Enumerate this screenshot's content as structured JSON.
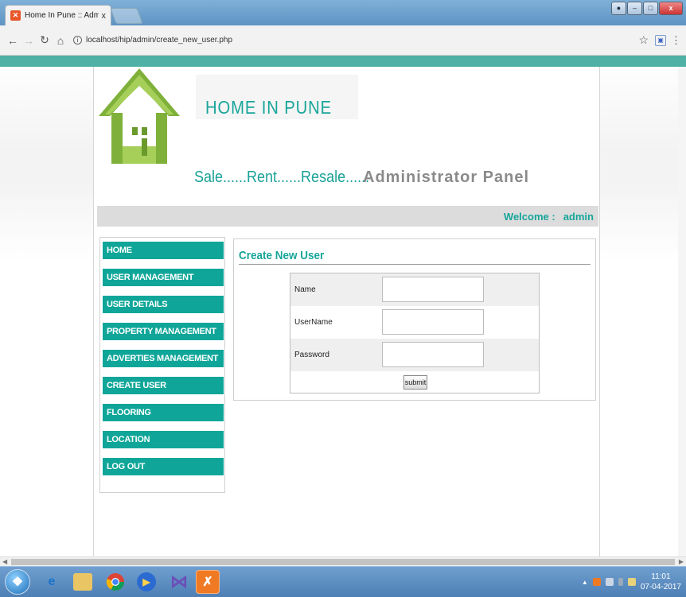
{
  "browser": {
    "tab_title": "Home In Pune :: Adminis",
    "tab_close": "x",
    "url": "localhost/hip/admin/create_new_user.php",
    "window_buttons": {
      "minimize": "–",
      "maximize": "□",
      "close": "x"
    }
  },
  "header": {
    "brand": "HOME IN PUNE",
    "tagline": "Sale......Rent......Resale......",
    "panel_title": "Administrator Panel"
  },
  "welcome": {
    "label": "Welcome :",
    "user": "admin"
  },
  "sidebar": {
    "items": [
      {
        "label": "HOME"
      },
      {
        "label": "USER MANAGEMENT"
      },
      {
        "label": "USER DETAILS"
      },
      {
        "label": "PROPERTY MANAGEMENT"
      },
      {
        "label": "ADVERTIES MANAGEMENT"
      },
      {
        "label": "CREATE USER"
      },
      {
        "label": "FLOORING"
      },
      {
        "label": "LOCATION"
      },
      {
        "label": "LOG OUT"
      }
    ]
  },
  "form": {
    "title": "Create New User",
    "fields": [
      {
        "label": "Name",
        "value": ""
      },
      {
        "label": "UserName",
        "value": ""
      },
      {
        "label": "Password",
        "value": ""
      }
    ],
    "submit_label": "submit"
  },
  "taskbar": {
    "time": "11:01",
    "date": "07-04-2017"
  },
  "colors": {
    "accent": "#0fa699",
    "stripe": "#4fb1a5",
    "panel_grey": "#8a8a8a"
  }
}
